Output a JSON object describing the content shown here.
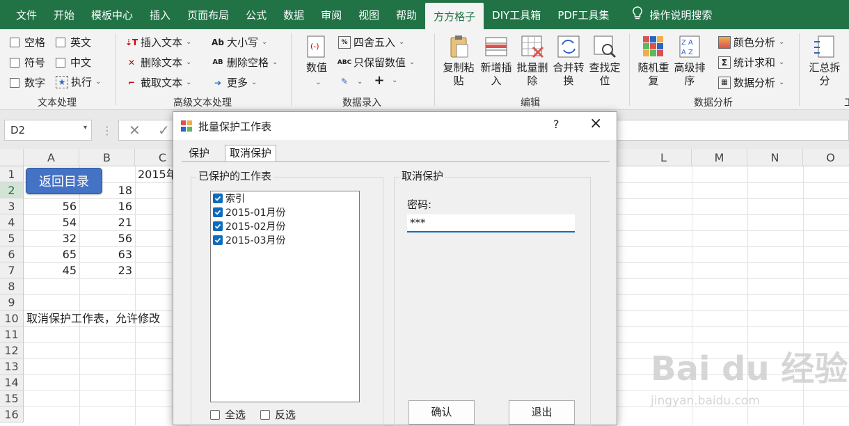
{
  "menu": {
    "tabs": [
      "文件",
      "开始",
      "模板中心",
      "插入",
      "页面布局",
      "公式",
      "数据",
      "审阅",
      "视图",
      "帮助",
      "方方格子",
      "DIY工具箱",
      "PDF工具集"
    ],
    "active_index": 10,
    "search_label": "操作说明搜索"
  },
  "ribbon": {
    "text_group": {
      "items": [
        "空格",
        "英文",
        "符号",
        "中文",
        "数字",
        "执行"
      ],
      "label": "文本处理"
    },
    "advanced_text": {
      "items": [
        "插入文本",
        "删除文本",
        "截取文本",
        "大小写",
        "删除空格",
        "更多"
      ],
      "label": "高级文本处理"
    },
    "data_entry": {
      "big_label": "数值",
      "items": [
        "四舍五入",
        "只保留数值"
      ],
      "label": "数据录入"
    },
    "edit": {
      "buttons": [
        "复制粘贴",
        "新增插入",
        "批量删除",
        "合并转换",
        "查找定位"
      ],
      "label": "编辑"
    },
    "analysis": {
      "buttons": [
        "随机重复",
        "高级排序"
      ],
      "items": [
        "颜色分析",
        "统计求和",
        "数据分析"
      ],
      "label": "数据分析"
    },
    "summary": {
      "button": "汇总拆分",
      "label": "工"
    }
  },
  "formula_bar": {
    "name_box": "D2",
    "formula": ""
  },
  "sheet": {
    "columns": [
      "A",
      "B",
      "C",
      "L",
      "M",
      "N",
      "O"
    ],
    "rows": [
      "1",
      "2",
      "3",
      "4",
      "5",
      "6",
      "7",
      "8",
      "9",
      "10",
      "11",
      "12",
      "13",
      "14",
      "15",
      "16"
    ],
    "back_button": "返回目录",
    "c1_text": "2015年",
    "a_values": [
      "",
      "",
      "56",
      "54",
      "32",
      "65",
      "45"
    ],
    "b_values": [
      "",
      "18",
      "16",
      "21",
      "56",
      "63",
      "23"
    ],
    "a10_text": "取消保护工作表，允许修改"
  },
  "dialog": {
    "title": "批量保护工作表",
    "help": "?",
    "close": "×",
    "tabs": [
      "保护",
      "取消保护"
    ],
    "active_tab": 1,
    "protected_group_label": "已保护的工作表",
    "sheets": [
      {
        "name": "索引",
        "checked": true
      },
      {
        "name": "2015-01月份",
        "checked": true
      },
      {
        "name": "2015-02月份",
        "checked": true
      },
      {
        "name": "2015-03月份",
        "checked": true
      }
    ],
    "select_all": "全选",
    "invert": "反选",
    "unprotect_group_label": "取消保护",
    "password_label": "密码:",
    "password_value": "***",
    "ok": "确认",
    "exit": "退出"
  },
  "watermark": {
    "main": "Bai du 经验",
    "sub": "jingyan.baidu.com"
  },
  "colors": {
    "excel_green": "#217346",
    "accent_blue": "#0f6cbd",
    "back_button": "#4472c4"
  }
}
